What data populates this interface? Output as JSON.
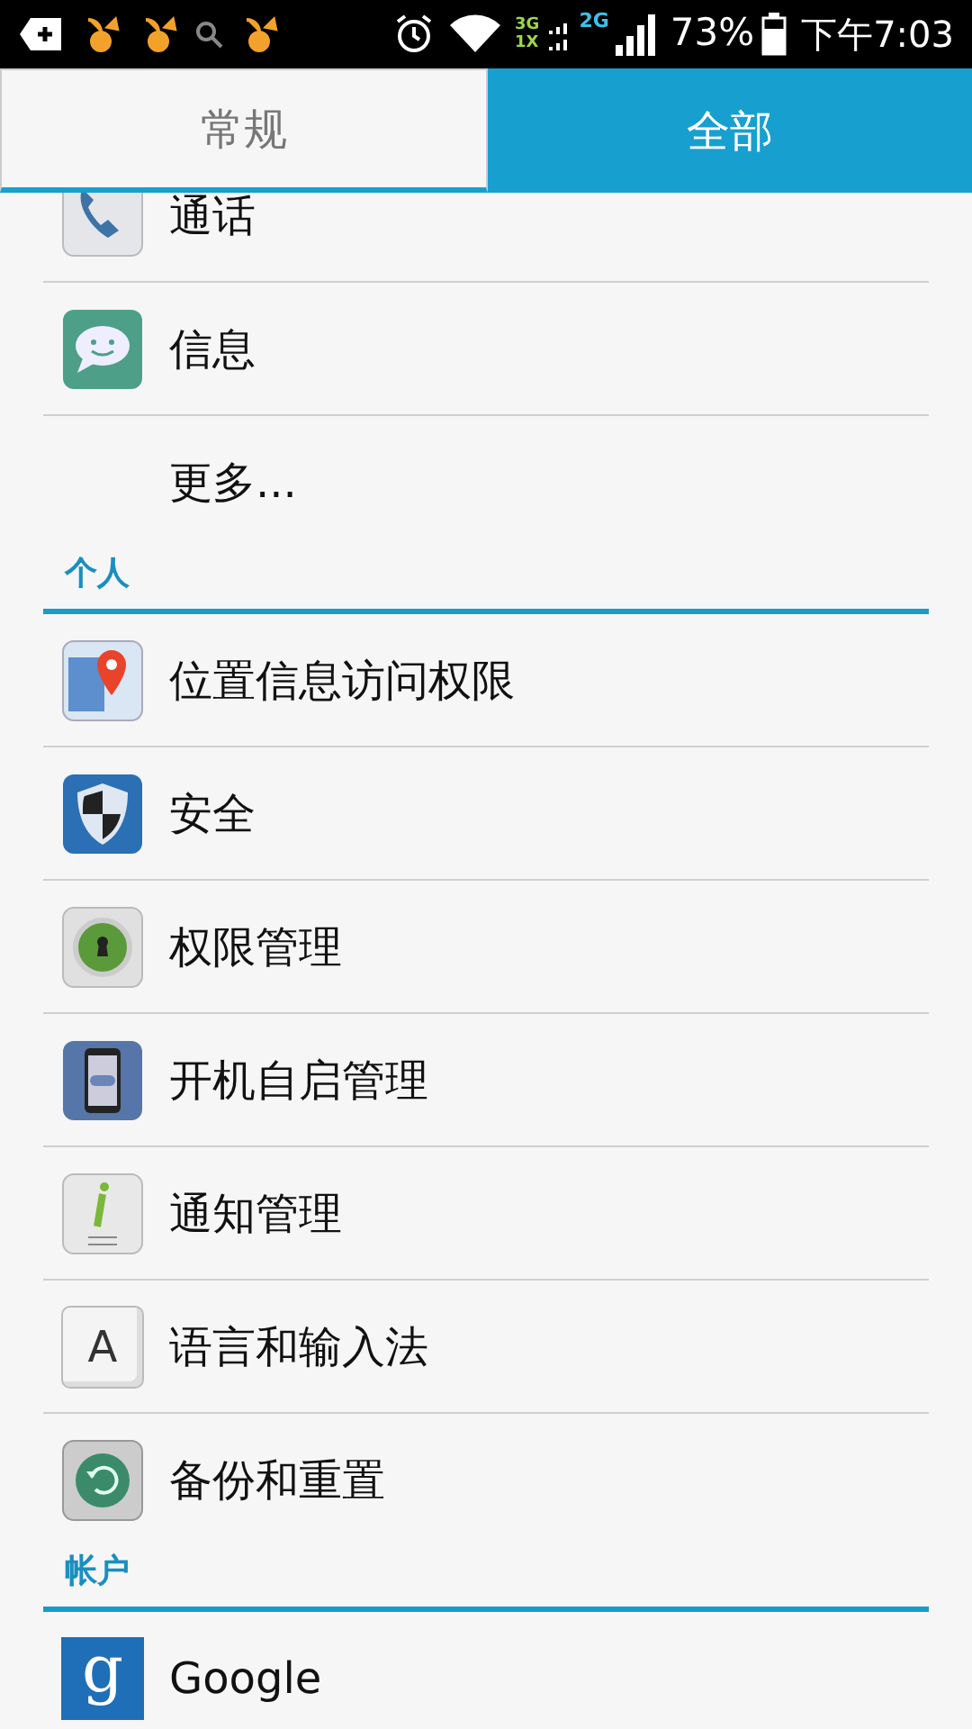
{
  "status_bar": {
    "network_1": "3G",
    "network_2": "1X",
    "network_3": "2G",
    "battery": "73%",
    "time": "下午7:03"
  },
  "tabs": [
    {
      "label": "常规",
      "selected": false
    },
    {
      "label": "全部",
      "selected": true
    }
  ],
  "sections": [
    {
      "items": [
        {
          "label": "通话",
          "kind": "phone"
        },
        {
          "label": "信息",
          "kind": "message"
        },
        {
          "label": "更多...",
          "kind": "plain"
        }
      ]
    },
    {
      "header": "个人",
      "items": [
        {
          "label": "位置信息访问权限",
          "kind": "location"
        },
        {
          "label": "安全",
          "kind": "shield"
        },
        {
          "label": "权限管理",
          "kind": "lock"
        },
        {
          "label": "开机自启管理",
          "kind": "startup"
        },
        {
          "label": "通知管理",
          "kind": "info"
        },
        {
          "label": "语言和输入法",
          "kind": "key",
          "icon_text": "A"
        },
        {
          "label": "备份和重置",
          "kind": "backup"
        }
      ]
    },
    {
      "header": "帐户",
      "items": [
        {
          "label": "Google",
          "kind": "letter",
          "icon_text": "g"
        }
      ]
    }
  ]
}
